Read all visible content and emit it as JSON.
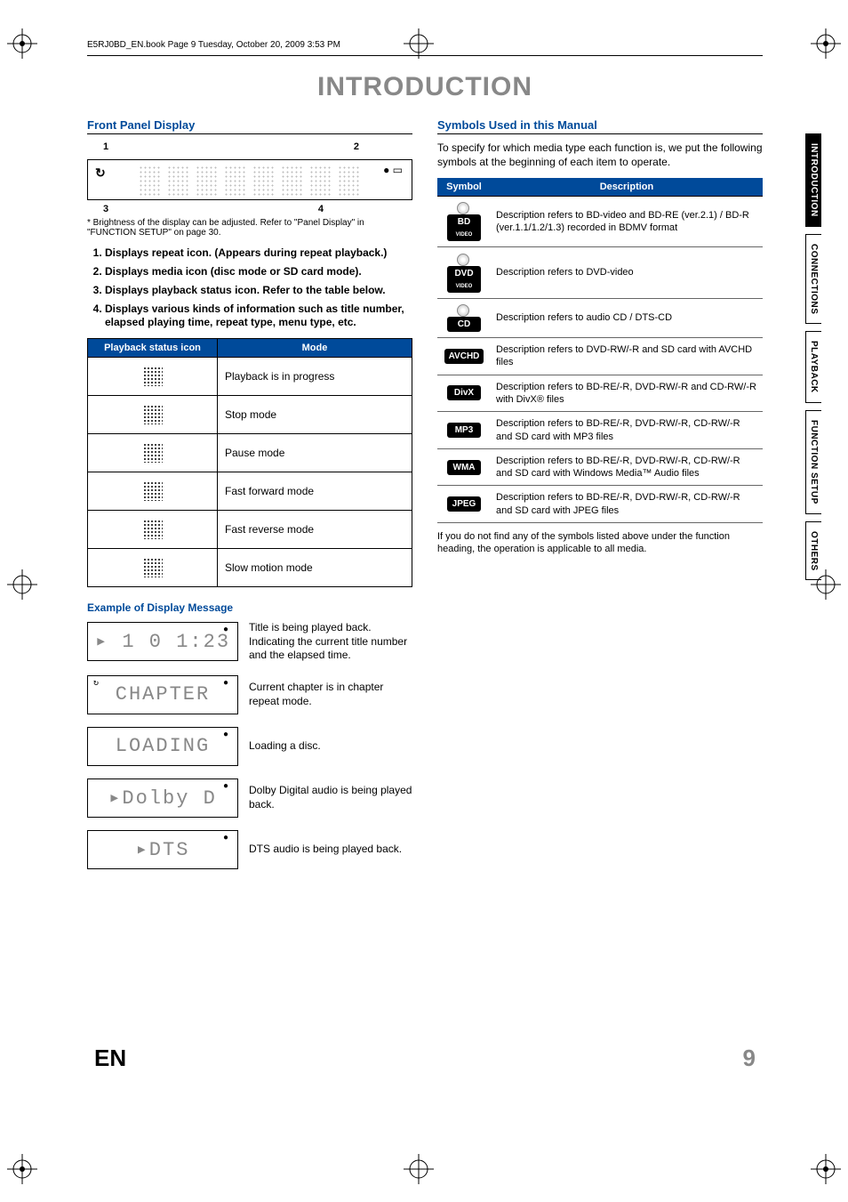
{
  "header_line": "E5RJ0BD_EN.book  Page 9  Tuesday, October 20, 2009  3:53 PM",
  "page_title": "INTRODUCTION",
  "front_panel": {
    "heading": "Front Panel Display",
    "labels_top": [
      "1",
      "2"
    ],
    "labels_bot": [
      "3",
      "4"
    ],
    "footnote": "* Brightness of the display can be adjusted. Refer to \"Panel Display\" in \"FUNCTION SETUP\" on page 30.",
    "items": [
      "Displays repeat icon. (Appears during repeat playback.)",
      "Displays media icon (disc mode or SD card mode).",
      "Displays playback status icon. Refer to the table below.",
      "Displays various kinds of information such as title number, elapsed playing time, repeat type, menu type, etc."
    ]
  },
  "status_table": {
    "headers": [
      "Playback status icon",
      "Mode"
    ],
    "rows": [
      {
        "mode": "Playback is in progress"
      },
      {
        "mode": "Stop mode"
      },
      {
        "mode": "Pause mode"
      },
      {
        "mode": "Fast forward mode"
      },
      {
        "mode": "Fast reverse mode"
      },
      {
        "mode": "Slow motion mode"
      }
    ]
  },
  "examples": {
    "heading": "Example of Display Message",
    "rows": [
      {
        "display": "▸ 1    0 1:23",
        "desc": "Title is being played back.\nIndicating the current title number and the elapsed time."
      },
      {
        "display": "CHAPTER",
        "desc": "Current chapter is in chapter repeat mode.",
        "repeat": true
      },
      {
        "display": "LOADING",
        "desc": "Loading a disc."
      },
      {
        "display": "▸Dolby D",
        "desc": "Dolby Digital audio is being played back."
      },
      {
        "display": "▸DTS",
        "desc": "DTS audio is being played back."
      }
    ]
  },
  "symbols": {
    "heading": "Symbols Used in this Manual",
    "intro": "To specify for which media type each function is, we put the following symbols at the beginning of each item to operate.",
    "headers": [
      "Symbol",
      "Description"
    ],
    "rows": [
      {
        "sym": "BD",
        "disc": true,
        "sub": "VIDEO",
        "desc": "Description refers to BD-video and BD-RE (ver.2.1) / BD-R (ver.1.1/1.2/1.3) recorded in BDMV format"
      },
      {
        "sym": "DVD",
        "disc": true,
        "sub": "VIDEO",
        "desc": "Description refers to DVD-video"
      },
      {
        "sym": "CD",
        "disc": true,
        "desc": "Description refers to audio CD / DTS-CD"
      },
      {
        "sym": "AVCHD",
        "desc": "Description refers to DVD-RW/-R and SD card with AVCHD files"
      },
      {
        "sym": "DivX",
        "desc": "Description refers to BD-RE/-R, DVD-RW/-R and CD-RW/-R with DivX® files"
      },
      {
        "sym": "MP3",
        "desc": "Description refers to BD-RE/-R, DVD-RW/-R, CD-RW/-R and SD card with MP3 files"
      },
      {
        "sym": "WMA",
        "desc": "Description refers to BD-RE/-R, DVD-RW/-R, CD-RW/-R and SD card with Windows Media™ Audio files"
      },
      {
        "sym": "JPEG",
        "desc": "Description refers to BD-RE/-R, DVD-RW/-R, CD-RW/-R and SD card with JPEG files"
      }
    ],
    "footnote": "If you do not find any of the symbols listed above under the function heading, the operation is applicable to all media."
  },
  "side_tabs": [
    "INTRODUCTION",
    "CONNECTIONS",
    "PLAYBACK",
    "FUNCTION SETUP",
    "OTHERS"
  ],
  "footer": {
    "lang": "EN",
    "page": "9"
  }
}
